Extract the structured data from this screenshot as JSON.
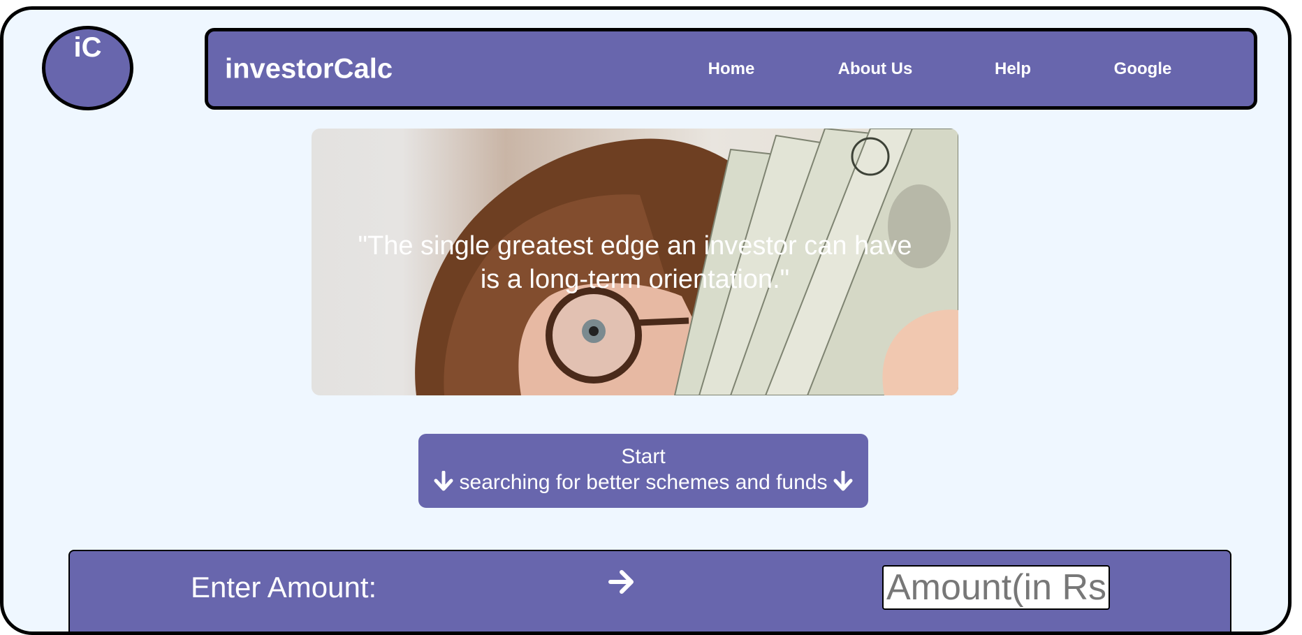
{
  "logo": {
    "text": "iC"
  },
  "navbar": {
    "brand": "investorCalc",
    "links": [
      "Home",
      "About Us",
      "Help",
      "Google"
    ]
  },
  "hero": {
    "quote_line1": "\"The single greatest edge an investor can have",
    "quote_line2": "is a long-term orientation.\""
  },
  "start_button": {
    "line1": "Start",
    "line2": "searching for better schemes and funds"
  },
  "amount": {
    "label": "Enter Amount:",
    "placeholder": "Amount(in Rs)"
  },
  "colors": {
    "page_bg": "#eff7ff",
    "accent": "#6866ad",
    "border": "#000000"
  }
}
